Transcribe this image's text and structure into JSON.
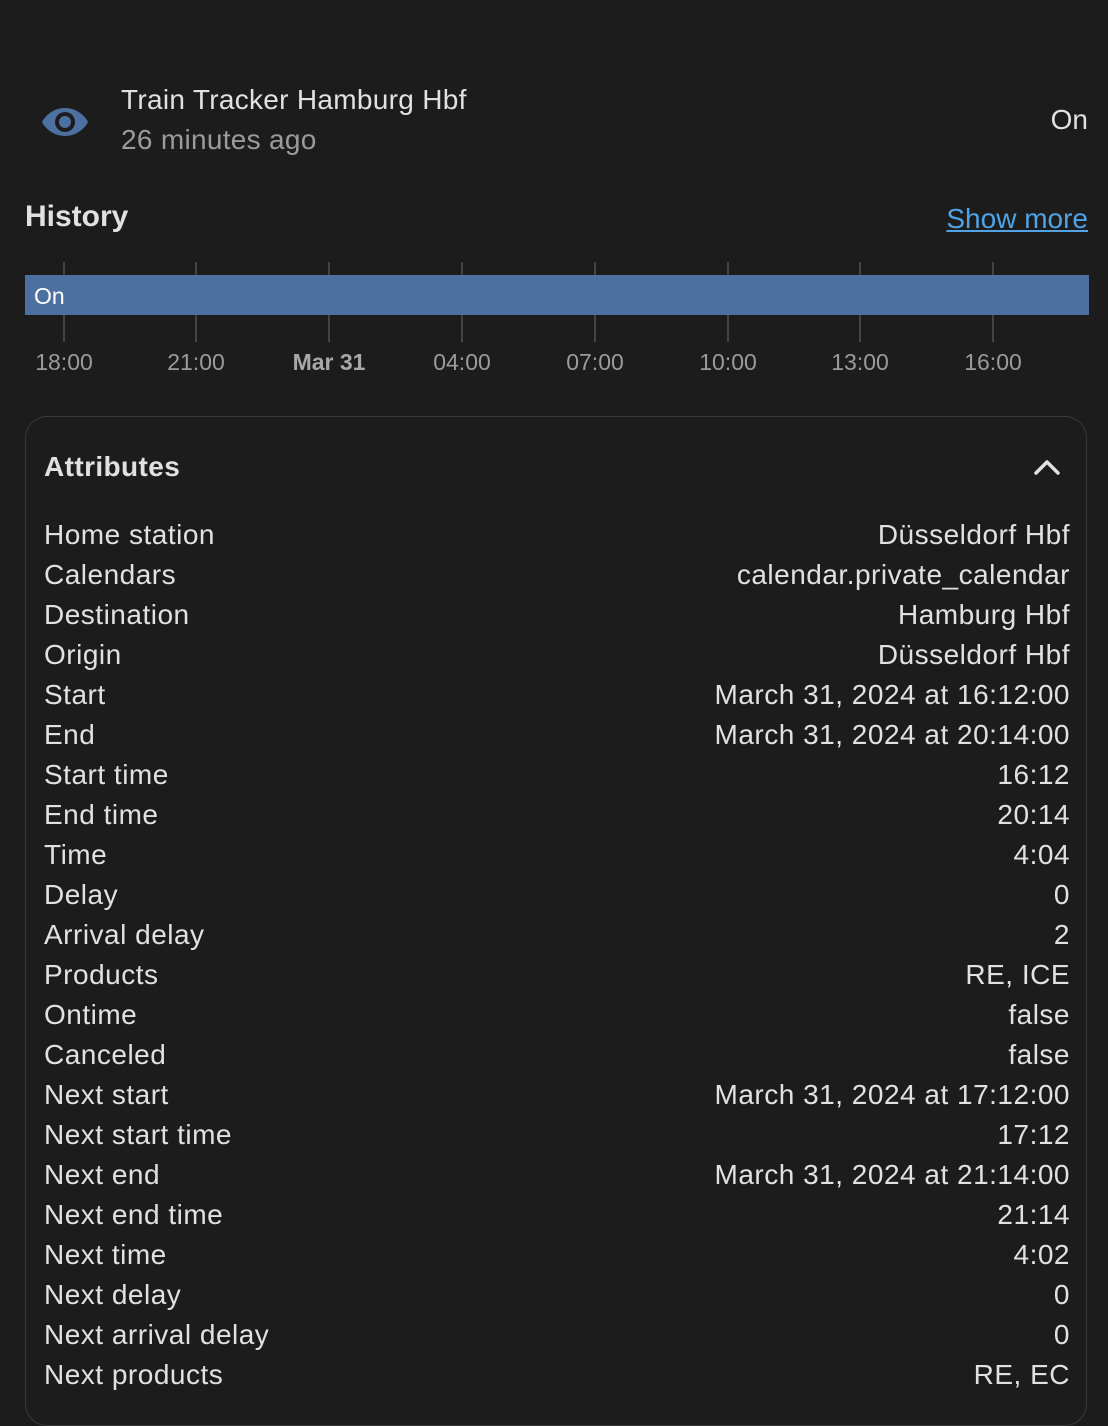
{
  "entity": {
    "name": "Train Tracker Hamburg Hbf",
    "last_changed": "26 minutes ago",
    "state": "On",
    "icon": "eye-icon",
    "icon_color": "#4c71a0"
  },
  "history": {
    "title": "History",
    "show_more_label": "Show more",
    "bar_label": "On",
    "bar_color": "#4c71a0",
    "ticks": [
      "18:00",
      "21:00",
      "Mar 31",
      "04:00",
      "07:00",
      "10:00",
      "13:00",
      "16:00"
    ]
  },
  "attributes": {
    "title": "Attributes",
    "rows": [
      {
        "key": "Home station",
        "value": "Düsseldorf Hbf"
      },
      {
        "key": "Calendars",
        "value": "calendar.private_calendar"
      },
      {
        "key": "Destination",
        "value": "Hamburg Hbf"
      },
      {
        "key": "Origin",
        "value": "Düsseldorf Hbf"
      },
      {
        "key": "Start",
        "value": "March 31, 2024 at 16:12:00"
      },
      {
        "key": "End",
        "value": "March 31, 2024 at 20:14:00"
      },
      {
        "key": "Start time",
        "value": "16:12"
      },
      {
        "key": "End time",
        "value": "20:14"
      },
      {
        "key": "Time",
        "value": "4:04"
      },
      {
        "key": "Delay",
        "value": "0"
      },
      {
        "key": "Arrival delay",
        "value": "2"
      },
      {
        "key": "Products",
        "value": "RE, ICE"
      },
      {
        "key": "Ontime",
        "value": "false"
      },
      {
        "key": "Canceled",
        "value": "false"
      },
      {
        "key": "Next start",
        "value": "March 31, 2024 at 17:12:00"
      },
      {
        "key": "Next start time",
        "value": "17:12"
      },
      {
        "key": "Next end",
        "value": "March 31, 2024 at 21:14:00"
      },
      {
        "key": "Next end time",
        "value": "21:14"
      },
      {
        "key": "Next time",
        "value": "4:02"
      },
      {
        "key": "Next delay",
        "value": "0"
      },
      {
        "key": "Next arrival delay",
        "value": "0"
      },
      {
        "key": "Next products",
        "value": "RE, EC"
      }
    ]
  }
}
